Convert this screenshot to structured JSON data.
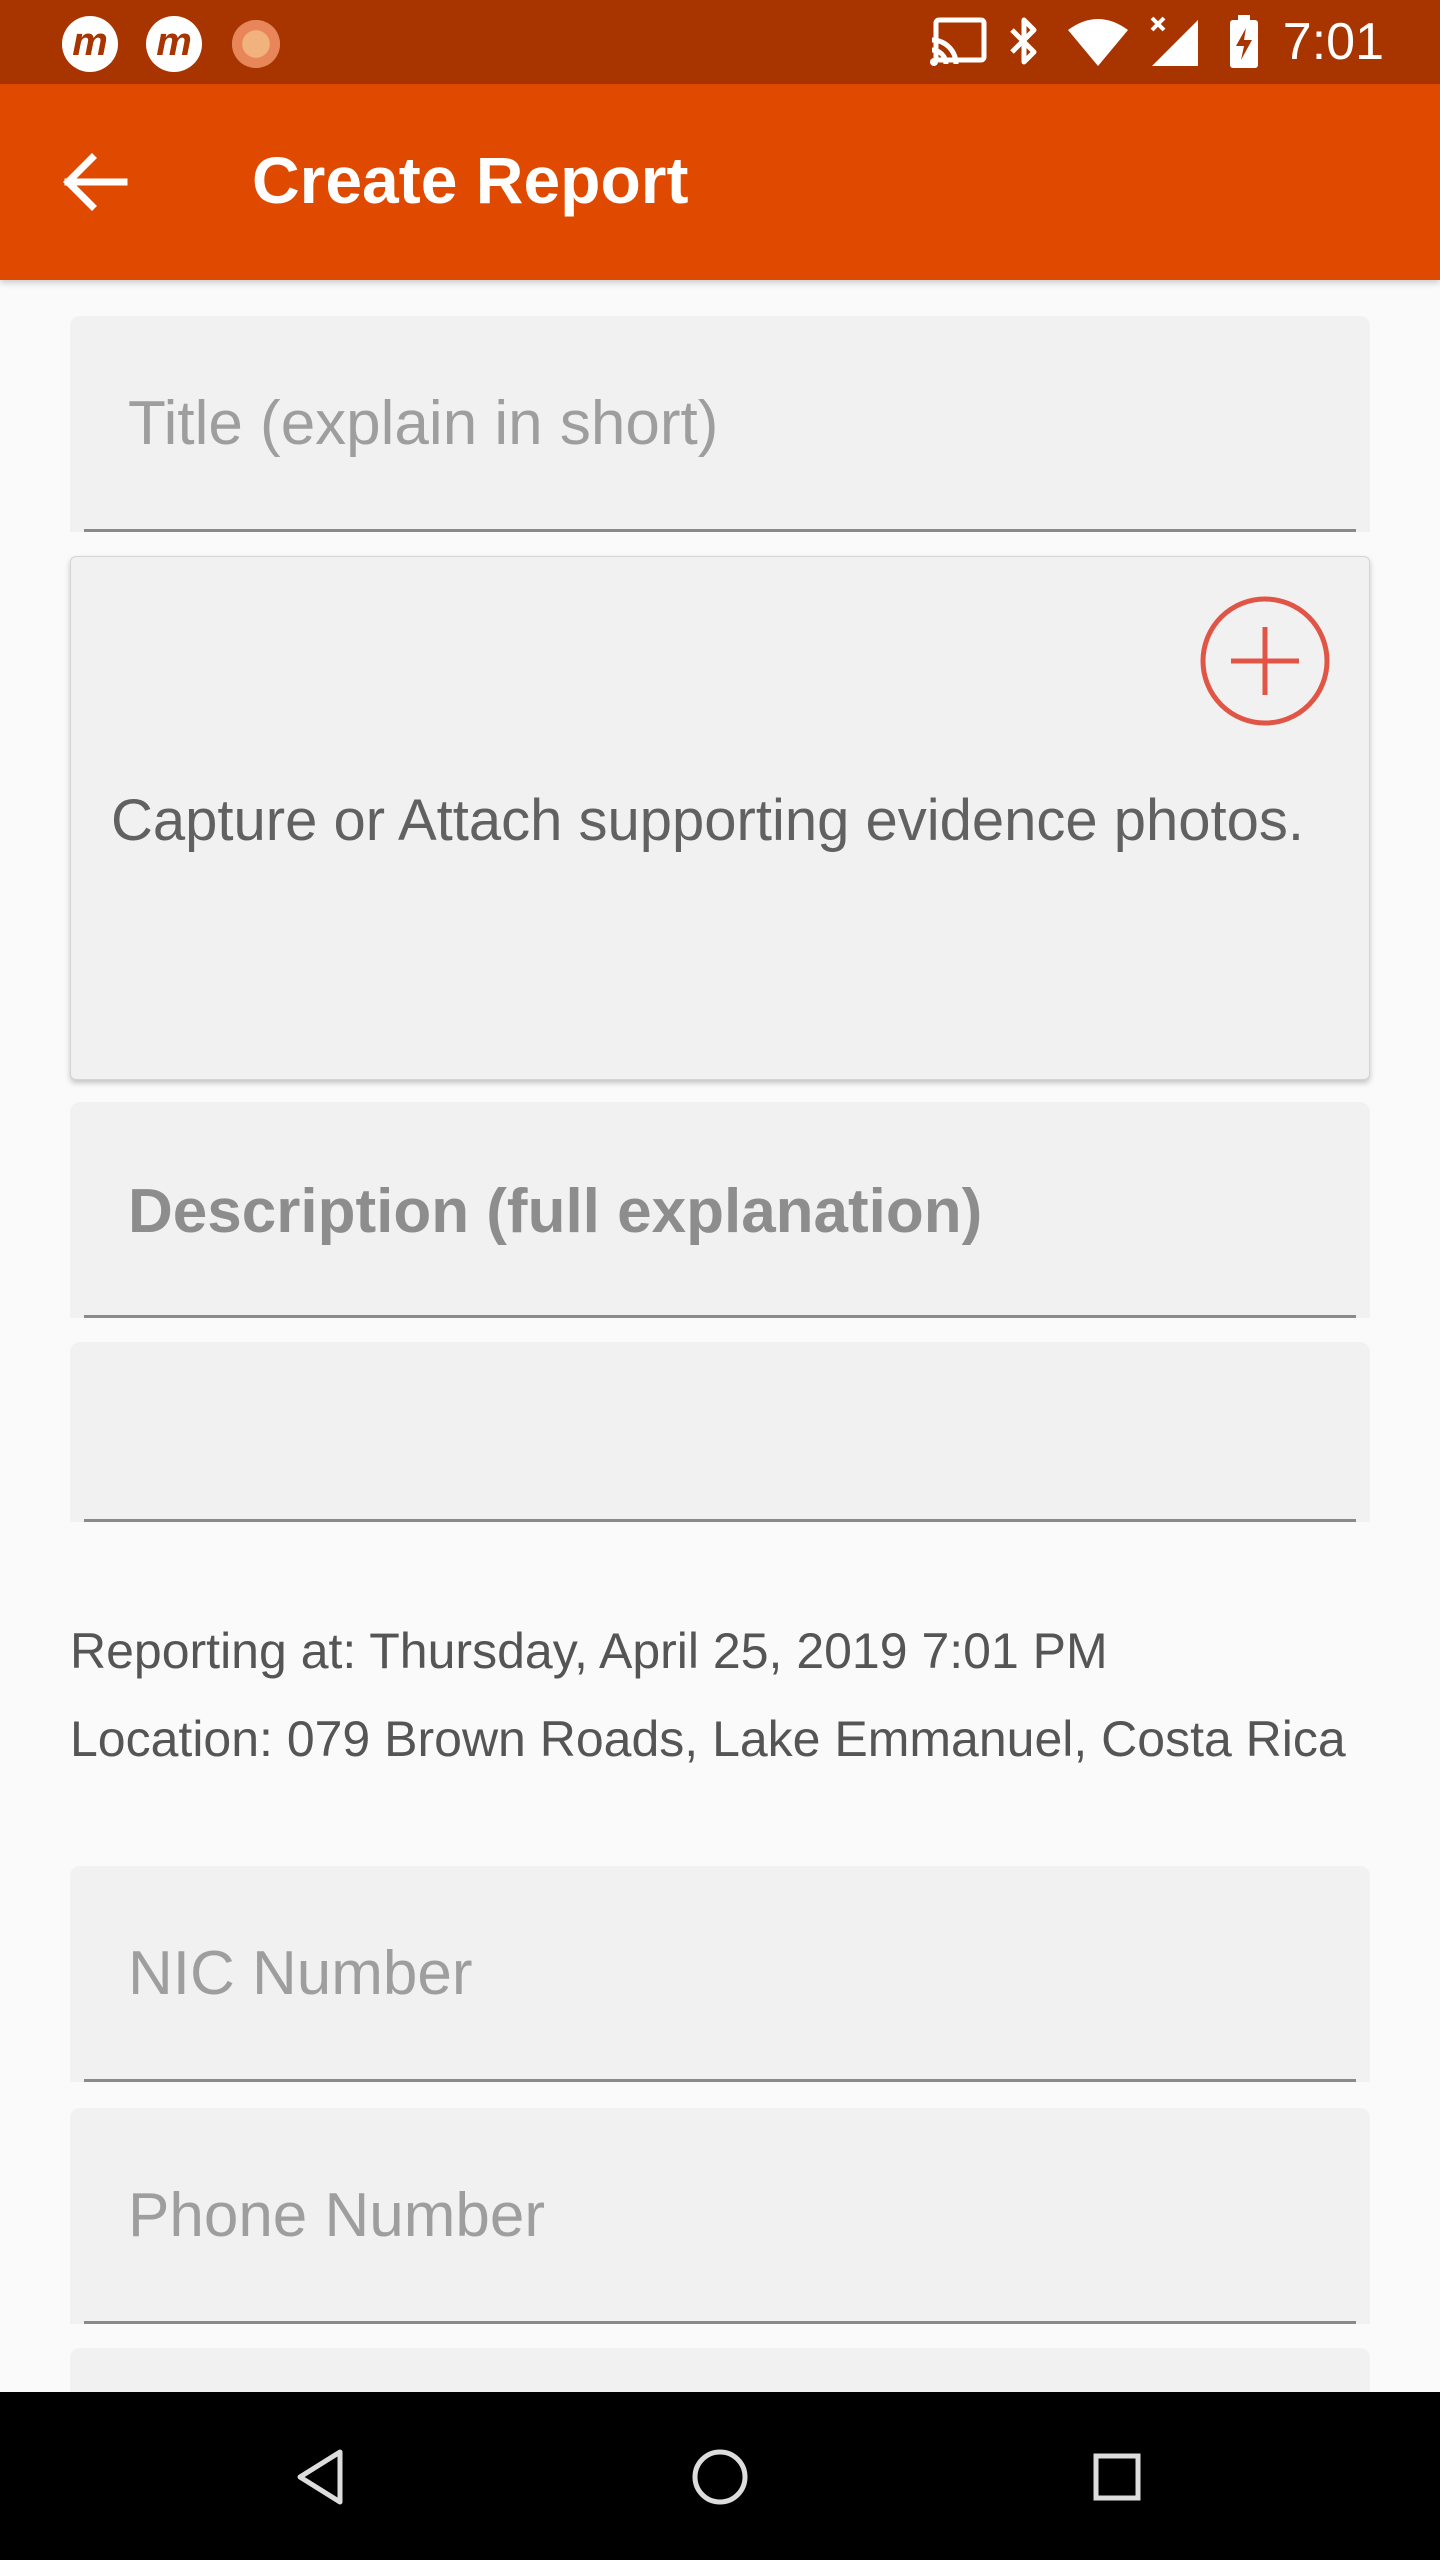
{
  "status_bar": {
    "app_icon_letter": "m",
    "time": "7:01",
    "icons": [
      "app-m-icon",
      "app-m-icon",
      "loader-icon",
      "cast-icon",
      "bluetooth-icon",
      "wifi-icon",
      "signal-icon",
      "battery-charging-icon"
    ]
  },
  "toolbar": {
    "title": "Create Report",
    "back_icon": "arrow-back-icon",
    "color": "#e04a00"
  },
  "form": {
    "title_placeholder": "Title (explain in short)",
    "photos_hint": "Capture or Attach supporting evidence photos.",
    "add_photo_icon": "plus-circle-icon",
    "description_placeholder": "Description (full explanation)",
    "reporting_at": "Reporting at: Thursday, April 25, 2019 7:01 PM",
    "location": "Location: 079 Brown Roads, Lake Emmanuel, Costa Rica",
    "nic_placeholder": "NIC Number",
    "phone_placeholder": "Phone Number"
  },
  "nav_bar": {
    "icons": [
      "back-triangle-icon",
      "home-circle-icon",
      "recents-square-icon"
    ]
  },
  "colors": {
    "status_bar": "#a83400",
    "accent": "#e04a00",
    "add_button": "#e05545"
  }
}
